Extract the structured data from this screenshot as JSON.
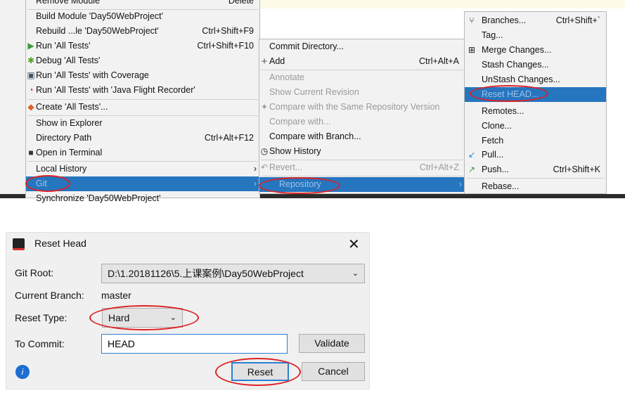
{
  "context_menu": {
    "items": [
      {
        "label": "Remove Module",
        "shortcut": "Delete"
      },
      {
        "label": "Build Module 'Day50WebProject'",
        "shortcut": ""
      },
      {
        "label": "Rebuild ...le 'Day50WebProject'",
        "shortcut": "Ctrl+Shift+F9"
      },
      {
        "label": "Run 'All Tests'",
        "shortcut": "Ctrl+Shift+F10",
        "icon": "run-icon"
      },
      {
        "label": "Debug 'All Tests'",
        "shortcut": "",
        "icon": "debug-icon"
      },
      {
        "label": "Run 'All Tests' with Coverage",
        "shortcut": "",
        "icon": "coverage-icon"
      },
      {
        "label": "Run 'All Tests' with 'Java Flight Recorder'",
        "shortcut": "",
        "icon": "profiler-icon"
      },
      {
        "label": "Create 'All Tests'...",
        "shortcut": "",
        "icon": "create-test-icon"
      },
      {
        "label": "Show in Explorer",
        "shortcut": ""
      },
      {
        "label": "Directory Path",
        "shortcut": "Ctrl+Alt+F12"
      },
      {
        "label": "Open in Terminal",
        "shortcut": "",
        "icon": "terminal-icon"
      },
      {
        "label": "Local History",
        "shortcut": ""
      },
      {
        "label": "Git",
        "shortcut": ""
      },
      {
        "label": "Synchronize 'Day50WebProject'",
        "shortcut": ""
      }
    ]
  },
  "git_menu": {
    "items": [
      {
        "label": "Commit Directory...",
        "shortcut": ""
      },
      {
        "label": "Add",
        "shortcut": "Ctrl+Alt+A"
      },
      {
        "label": "Annotate",
        "shortcut": ""
      },
      {
        "label": "Show Current Revision",
        "shortcut": ""
      },
      {
        "label": "Compare with the Same Repository Version",
        "shortcut": ""
      },
      {
        "label": "Compare with...",
        "shortcut": ""
      },
      {
        "label": "Compare with Branch...",
        "shortcut": ""
      },
      {
        "label": "Show History",
        "shortcut": ""
      },
      {
        "label": "Revert...",
        "shortcut": "Ctrl+Alt+Z"
      },
      {
        "label": "Repository",
        "shortcut": ""
      }
    ]
  },
  "repository_menu": {
    "items": [
      {
        "label": "Branches...",
        "shortcut": "Ctrl+Shift+`"
      },
      {
        "label": "Tag...",
        "shortcut": ""
      },
      {
        "label": "Merge Changes...",
        "shortcut": ""
      },
      {
        "label": "Stash Changes...",
        "shortcut": ""
      },
      {
        "label": "UnStash Changes...",
        "shortcut": ""
      },
      {
        "label": "Reset HEAD...",
        "shortcut": ""
      },
      {
        "label": "Remotes...",
        "shortcut": ""
      },
      {
        "label": "Clone...",
        "shortcut": ""
      },
      {
        "label": "Fetch",
        "shortcut": ""
      },
      {
        "label": "Pull...",
        "shortcut": ""
      },
      {
        "label": "Push...",
        "shortcut": "Ctrl+Shift+K"
      },
      {
        "label": "Rebase...",
        "shortcut": ""
      }
    ]
  },
  "dialog": {
    "title": "Reset Head",
    "git_root_label": "Git Root:",
    "git_root_value": "D:\\1.20181126\\5.上课案例\\Day50WebProject",
    "current_branch_label": "Current Branch:",
    "current_branch_value": "master",
    "reset_type_label": "Reset Type:",
    "reset_type_value": "Hard",
    "to_commit_label": "To Commit:",
    "to_commit_value": "HEAD",
    "validate_label": "Validate",
    "reset_label": "Reset",
    "cancel_label": "Cancel"
  },
  "colors": {
    "selection": "#2675bf",
    "highlight_ellipse": "#d22222",
    "menu_bg": "#f2f2f2"
  }
}
